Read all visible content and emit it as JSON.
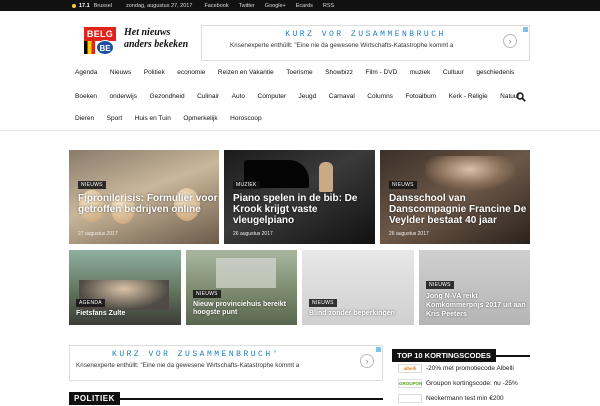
{
  "topbar": {
    "temperature": "17.1",
    "city": "Brussel",
    "date": "zondag, augustus 27, 2017",
    "links": [
      "Facebook",
      "Twitter",
      "Google+",
      "Ecards",
      "RSS"
    ]
  },
  "header": {
    "logo_top": "BELG",
    "logo_bottom": "BE",
    "tagline_1": "Het nieuws",
    "tagline_2": "anders bekeken"
  },
  "ad": {
    "title": "KURZ VOR ZUSAMMENBRUCH",
    "text": "Krisenexperte enthüllt: \"Eine nie da gewesene Wirtschafts-Katastrophe kommt a",
    "title2": "KURZ VOR ZUSAMMENBRUCH'"
  },
  "nav": {
    "row1": [
      "Agenda",
      "Nieuws",
      "Politiek",
      "economie",
      "Reizen en Vakantie",
      "Toerisme",
      "Showbizz",
      "Film - DVD",
      "muziek",
      "Cultuur",
      "geschiedenis"
    ],
    "row2": [
      "Boeken",
      "onderwijs",
      "Gezondheid",
      "Culinair",
      "Auto",
      "Computer",
      "Jeugd",
      "Carnaval",
      "Columns",
      "Fotoalbum",
      "Kerk - Religie",
      "Natuur"
    ],
    "row3": [
      "Dieren",
      "Sport",
      "Huis en Tuin",
      "Opmerkelijk",
      "Horoscoop"
    ]
  },
  "featured": [
    {
      "category": "NIEUWS",
      "title": "Fipronilcrisis: Formulier voor getroffen bedrijven online",
      "date": "27 augustus 2017"
    },
    {
      "category": "MUZIEK",
      "title": "Piano spelen in de bib: De Krook krijgt vaste vleugelpiano",
      "date": "26 augustus 2017"
    },
    {
      "category": "NIEUWS",
      "title": "Dansschool van Danscompagnie Francine De Veylder bestaat 40 jaar",
      "date": "26 augustus 2017"
    }
  ],
  "small": [
    {
      "category": "AGENDA",
      "title": "Fietsfans Zulte"
    },
    {
      "category": "NIEUWS",
      "title": "Nieuw provinciehuis bereikt hoogste punt"
    },
    {
      "category": "NIEUWS",
      "title": "Blind zonder beperkingen"
    },
    {
      "category": "NIEUWS",
      "title": "Jong N-VA reikt Komkommerprijs 2017 uit aan Kris Peeters"
    }
  ],
  "sections": {
    "politiek": "POLITIEK",
    "top10": "TOP 10 KORTINGSCODES"
  },
  "kortingscodes": [
    {
      "logo": "albelli",
      "text": "-20% met promotiecode Albelli"
    },
    {
      "logo": "GROUPON",
      "text": "Groupon kortingscode: nu -25%"
    },
    {
      "logo": "",
      "text": "Neckermann test min €200"
    }
  ],
  "colors": {
    "accent": "#e2231a",
    "ad_title": "#1f7fbf",
    "dark": "#111111"
  }
}
